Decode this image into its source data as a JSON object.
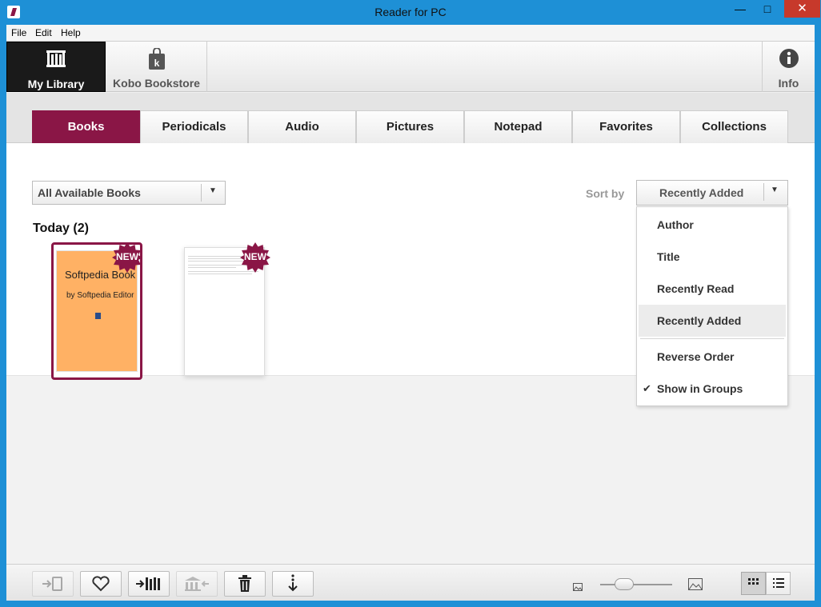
{
  "window": {
    "title": "Reader for PC"
  },
  "menu": [
    "File",
    "Edit",
    "Help"
  ],
  "nav": {
    "library": "My Library",
    "store": "Kobo Bookstore",
    "info": "Info"
  },
  "tabs": [
    {
      "label": "Books",
      "active": true
    },
    {
      "label": "Periodicals"
    },
    {
      "label": "Audio"
    },
    {
      "label": "Pictures"
    },
    {
      "label": "Notepad"
    },
    {
      "label": "Favorites"
    },
    {
      "label": "Collections"
    }
  ],
  "filter": {
    "value": "All Available Books"
  },
  "sort": {
    "label": "Sort by",
    "value": "Recently Added",
    "options": [
      "Author",
      "Title",
      "Recently Read",
      "Recently Added"
    ],
    "extra": [
      "Reverse Order",
      "Show in Groups"
    ]
  },
  "group": {
    "heading": "Today (2)"
  },
  "books": [
    {
      "cover_title": "Softpedia Book",
      "cover_author": "by Softpedia Editor",
      "badge": "NEW",
      "cover_color": "#ffb164"
    },
    {
      "badge": "NEW"
    }
  ],
  "colors": {
    "accent": "#8a1646",
    "titlebar": "#1e90d6"
  }
}
